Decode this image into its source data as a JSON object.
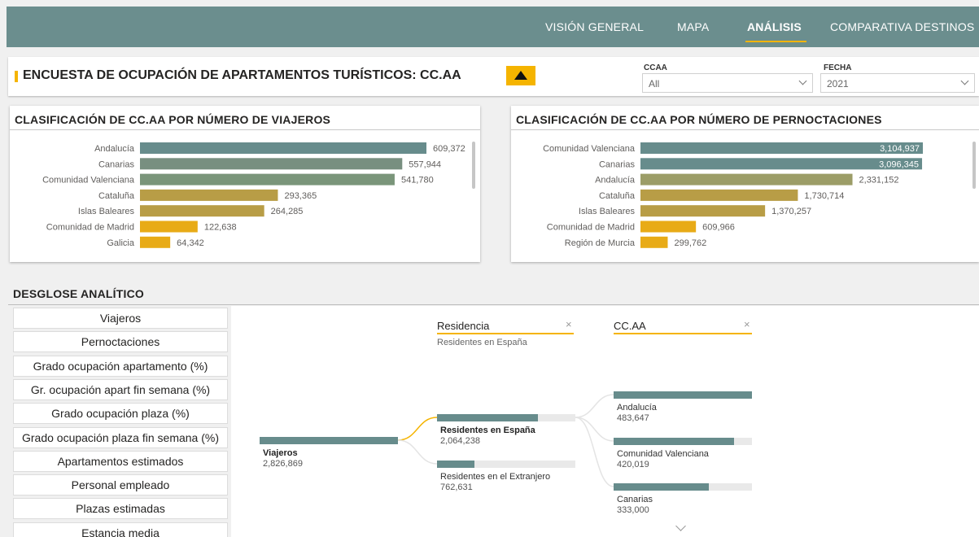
{
  "nav": {
    "items": [
      {
        "label": "VISIÓN GENERAL",
        "active": false
      },
      {
        "label": "MAPA",
        "active": false
      },
      {
        "label": "ANÁLISIS",
        "active": true
      },
      {
        "label": "COMPARATIVA DESTINOS",
        "active": false
      }
    ]
  },
  "header": {
    "title": "ENCUESTA DE OCUPACIÓN DE APARTAMENTOS TURÍSTICOS: CC.AA",
    "collapse_icon": "triangle-up-icon",
    "filters": [
      {
        "label": "CCAA",
        "value": "All"
      },
      {
        "label": "FECHA",
        "value": "2021"
      }
    ]
  },
  "colors": {
    "teal": "#678c8c",
    "sage": "#889f82",
    "olive": "#9c9d67",
    "gold": "#b89d46",
    "amber": "#e8ab17",
    "accent": "#f5b400",
    "nav_bg": "#6b8e8e"
  },
  "chart_data": [
    {
      "type": "bar",
      "orientation": "horizontal",
      "title": "CLASIFICACIÓN DE CC.AA POR NÚMERO DE VIAJEROS",
      "categories": [
        "Andalucía",
        "Canarias",
        "Comunidad Valenciana",
        "Cataluña",
        "Islas Baleares",
        "Comunidad de Madrid",
        "Galicia"
      ],
      "values": [
        609372,
        557944,
        541780,
        293365,
        264285,
        122638,
        64342
      ],
      "value_labels": [
        "609,372",
        "557,944",
        "541,780",
        "293,365",
        "264,285",
        "122,638",
        "64,342"
      ],
      "bar_colors": [
        "#678c8c",
        "#788f80",
        "#7a957a",
        "#b89d46",
        "#b89d46",
        "#e8ab17",
        "#e8ab17"
      ],
      "xlim": [
        0,
        609372
      ]
    },
    {
      "type": "bar",
      "orientation": "horizontal",
      "title": "CLASIFICACIÓN DE CC.AA POR NÚMERO DE PERNOCTACIONES",
      "categories": [
        "Comunidad Valenciana",
        "Canarias",
        "Andalucía",
        "Cataluña",
        "Islas Baleares",
        "Comunidad de Madrid",
        "Región de Murcia"
      ],
      "values": [
        3104937,
        3096345,
        2331152,
        1730714,
        1370257,
        609966,
        299762
      ],
      "value_labels": [
        "3,104,937",
        "3,096,345",
        "2,331,152",
        "1,730,714",
        "1,370,257",
        "609,966",
        "299,762"
      ],
      "bar_colors": [
        "#678c8c",
        "#678c8c",
        "#9c9d67",
        "#b89d46",
        "#b89d46",
        "#e8ab17",
        "#e8ab17"
      ],
      "xlim": [
        0,
        3104937
      ]
    }
  ],
  "desglose": {
    "title": "DESGLOSE ANALÍTICO",
    "measures": [
      "Viajeros",
      "Pernoctaciones",
      "Grado ocupación apartamento (%)",
      "Gr. ocupación apart fin semana (%)",
      "Grado ocupación plaza (%)",
      "Grado ocupación plaza fin semana (%)",
      "Apartamentos estimados",
      "Personal empleado",
      "Plazas estimadas",
      "Estancia media"
    ],
    "levels": [
      {
        "header": "Residencia",
        "sub": "Residentes en España",
        "close": "×"
      },
      {
        "header": "CC.AA",
        "sub": "",
        "close": "×"
      }
    ],
    "root": {
      "name": "Viajeros",
      "value": "2,826,869",
      "fraction": 1.0
    },
    "level1": [
      {
        "name": "Residentes en España",
        "value": "2,064,238",
        "fraction": 0.73,
        "selected": true
      },
      {
        "name": "Residentes en el Extranjero",
        "value": "762,631",
        "fraction": 0.27,
        "selected": false
      }
    ],
    "level2": [
      {
        "name": "Andalucía",
        "value": "483,647",
        "fraction": 1.0
      },
      {
        "name": "Comunidad Valenciana",
        "value": "420,019",
        "fraction": 0.87
      },
      {
        "name": "Canarias",
        "value": "333,000",
        "fraction": 0.69
      }
    ],
    "more_icon": "chevron-down-icon"
  }
}
